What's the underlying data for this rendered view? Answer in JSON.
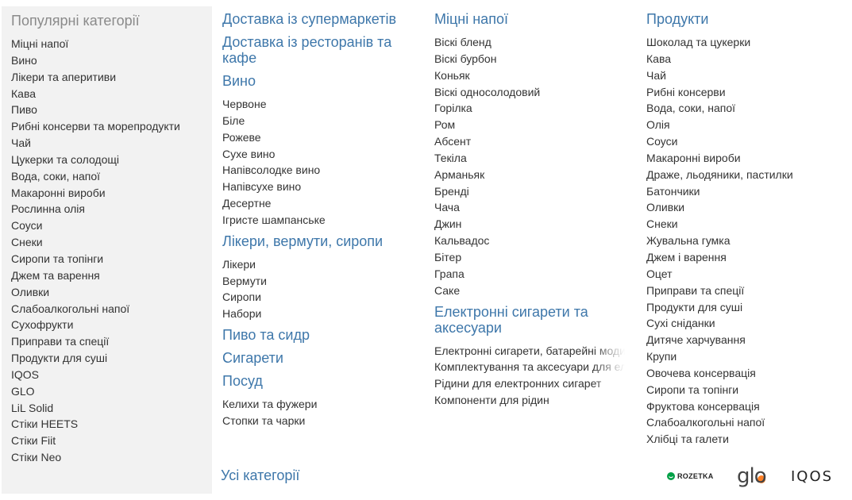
{
  "sidebar": {
    "title": "Популярні категорії",
    "items": [
      "Міцні напої",
      "Вино",
      "Лікери та аперитиви",
      "Кава",
      "Пиво",
      "Рибні консерви та морепродукти",
      "Чай",
      "Цукерки та солодощі",
      "Вода, соки, напої",
      "Макаронні вироби",
      "Рослинна олія",
      "Соуси",
      "Снеки",
      "Сиропи та топінги",
      "Джем та варення",
      "Оливки",
      "Слабоалкогольні напої",
      "Сухофрукти",
      "Приправи та спеції",
      "Продукти для суші",
      "IQOS",
      "GLO",
      "LiL Solid",
      "Стіки HEETS",
      "Стіки Fiit",
      "Стіки Neo"
    ]
  },
  "col1": {
    "supermarkets": "Доставка із супермаркетів",
    "restaurants": "Доставка із ресторанів та кафе",
    "wine": {
      "title": "Вино",
      "items": [
        "Червоне",
        "Біле",
        "Рожеве",
        "Сухе вино",
        "Напівсолодке вино",
        "Напівсухе вино",
        "Десертне",
        "Ігристе шампанське"
      ]
    },
    "liqueurs": {
      "title": "Лікери, вермути, сиропи",
      "items": [
        "Лікери",
        "Вермути",
        "Сиропи",
        "Набори"
      ]
    },
    "beer": "Пиво та сидр",
    "cigarettes": "Сигарети",
    "dishes": {
      "title": "Посуд",
      "items": [
        "Келихи та фужери",
        "Стопки та чарки"
      ]
    }
  },
  "col2": {
    "spirits": {
      "title": "Міцні напої",
      "items": [
        "Віскі бленд",
        "Віскі бурбон",
        "Коньяк",
        "Віскі односолодовий",
        "Горілка",
        "Ром",
        "Абсент",
        "Текіла",
        "Арманьяк",
        "Бренді",
        "Чача",
        "Джин",
        "Кальвадос",
        "Бітер",
        "Грапа",
        "Саке"
      ]
    },
    "ecig": {
      "title": "Електронні сигарети та аксесуари",
      "items": [
        "Електронні сигарети, батарейні моди",
        "Комплектування та аксесуари для електронних сигарет",
        "Рідини для електронних сигарет",
        "Компоненти для рідин"
      ]
    }
  },
  "col3": {
    "products": {
      "title": "Продукти",
      "items": [
        "Шоколад та цукерки",
        "Кава",
        "Чай",
        "Рибні консерви",
        "Вода, соки, напої",
        "Олія",
        "Соуси",
        "Макаронні вироби",
        "Драже, льодяники, пастилки",
        "Батончики",
        "Оливки",
        "Снеки",
        "Жувальна гумка",
        "Джем і варення",
        "Оцет",
        "Приправи та спеції",
        "Продукти для суші",
        "Сухі сніданки",
        "Дитяче харчування",
        "Крупи",
        "Овочева консервація",
        "Сиропи та топінги",
        "Фруктова консервація",
        "Слабоалкогольні напої",
        "Хлібці та галети"
      ]
    }
  },
  "footer": {
    "all_categories": "Усі категорії"
  },
  "brands": {
    "rozetka": "ROZETKA",
    "glo": "glo",
    "iqos": "IQOS",
    "rozetka_color": "#00a046",
    "glo_color": "#ff6a00"
  }
}
